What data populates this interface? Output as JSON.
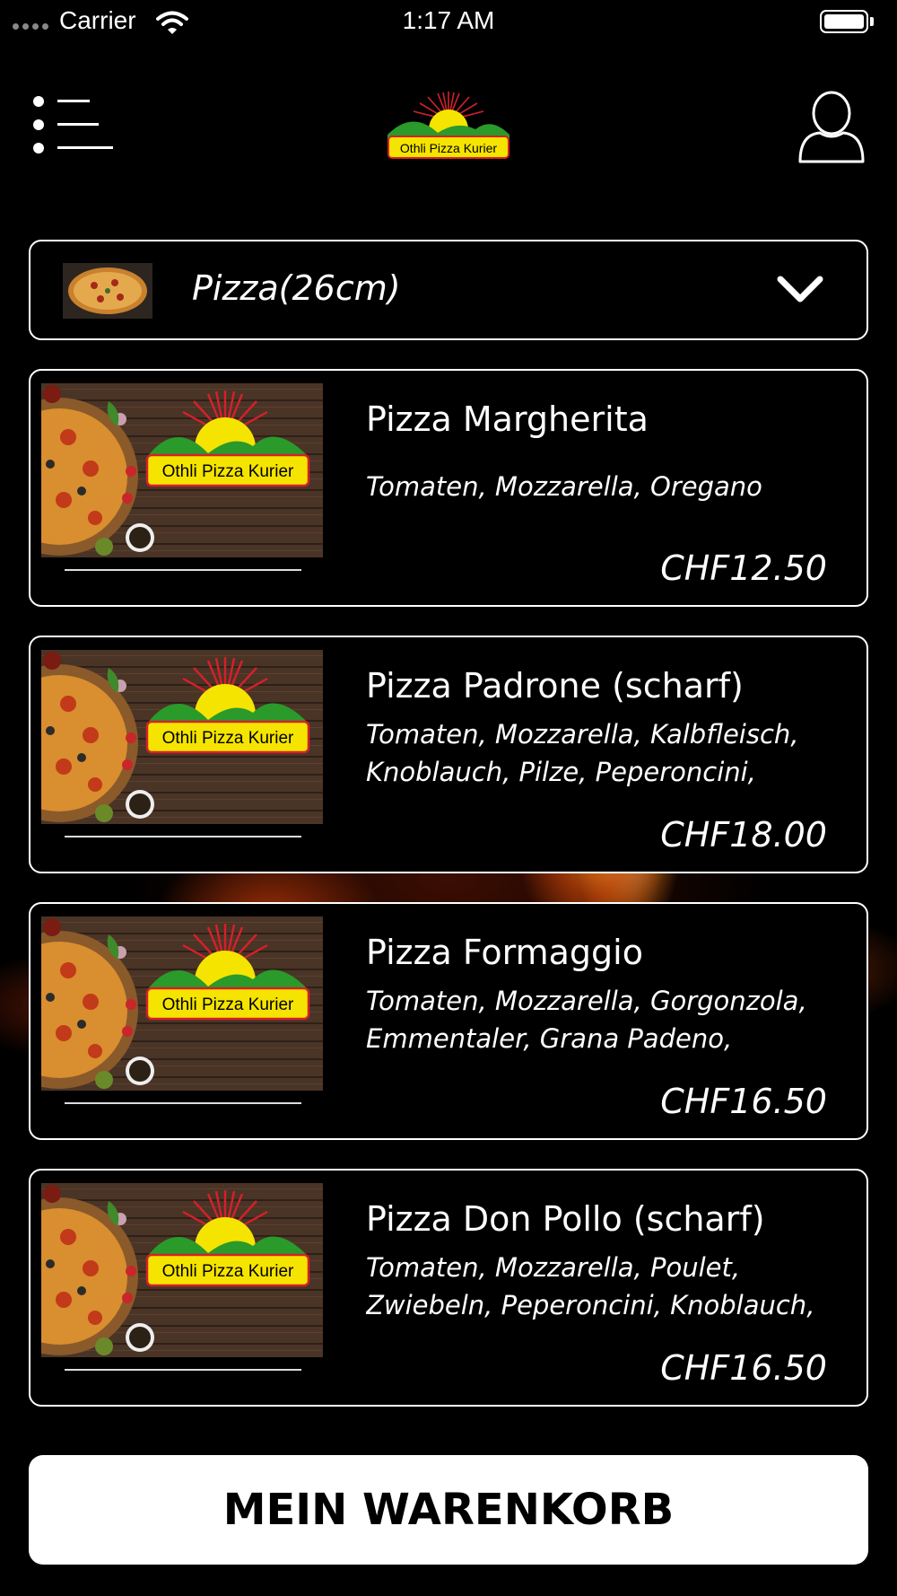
{
  "status_bar": {
    "carrier": "Carrier",
    "time": "1:17 AM"
  },
  "header": {
    "logo_text": "Othli Pizza Kurier"
  },
  "category": {
    "selected": "Pizza(26cm)"
  },
  "products": [
    {
      "title": "Pizza Margherita",
      "description": "Tomaten, Mozzarella, Oregano",
      "price": "CHF12.50"
    },
    {
      "title": "Pizza Padrone (scharf)",
      "description": "Tomaten, Mozzarella, Kalbfleisch, Knoblauch, Pilze, Peperoncini, Zwieb...",
      "price": "CHF18.00"
    },
    {
      "title": "Pizza Formaggio",
      "description": "Tomaten, Mozzarella, Gorgonzola, Emmentaler, Grana Padeno, Oregano",
      "price": "CHF16.50"
    },
    {
      "title": "Pizza Don Pollo (scharf)",
      "description": "Tomaten, Mozzarella, Poulet, Zwiebeln, Peperoncini, Knoblauch, Oregano",
      "price": "CHF16.50"
    }
  ],
  "cart": {
    "label": "MEIN WARENKORB"
  },
  "icons": {
    "menu": "list-menu-icon",
    "user": "user-profile-icon",
    "dropdown": "chevron-down-icon"
  },
  "colors": {
    "background": "#000000",
    "logo_yellow": "#f5e400",
    "logo_green": "#2a9a2a",
    "logo_red": "#d6202a"
  }
}
